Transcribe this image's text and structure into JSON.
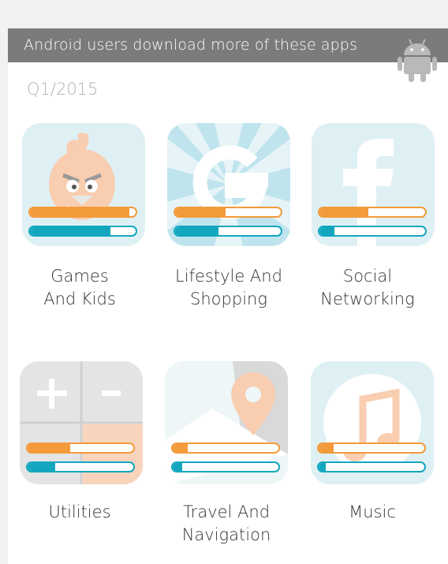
{
  "header": {
    "title": "Android users download more of these apps",
    "date": "Q1/2015",
    "icon": "android-robot-icon"
  },
  "colors": {
    "banner": "#7c7b79",
    "ios_bar": "#f39a3a",
    "android_bar": "#12a7bf",
    "tile_bg": "#dff0f4"
  },
  "categories": [
    {
      "line1": "Games",
      "line2": "And Kids",
      "icon": "angry-bird-icon",
      "orange_level": 0.94,
      "teal_level": 0.76
    },
    {
      "line1": "Lifestyle And",
      "line2": "Shopping",
      "icon": "google-g-icon",
      "orange_level": 0.48,
      "teal_level": 0.41
    },
    {
      "line1": "Social",
      "line2": "Networking",
      "icon": "facebook-f-icon",
      "orange_level": 0.46,
      "teal_level": 0.14
    },
    {
      "line1": "Utilities",
      "line2": "",
      "icon": "calculator-icon",
      "orange_level": 0.4,
      "teal_level": 0.26
    },
    {
      "line1": "Travel And",
      "line2": "Navigation",
      "icon": "map-pin-icon",
      "orange_level": 0.14,
      "teal_level": 0.09
    },
    {
      "line1": "Music",
      "line2": "",
      "icon": "music-note-icon",
      "orange_level": 0.14,
      "teal_level": 0.07
    }
  ]
}
